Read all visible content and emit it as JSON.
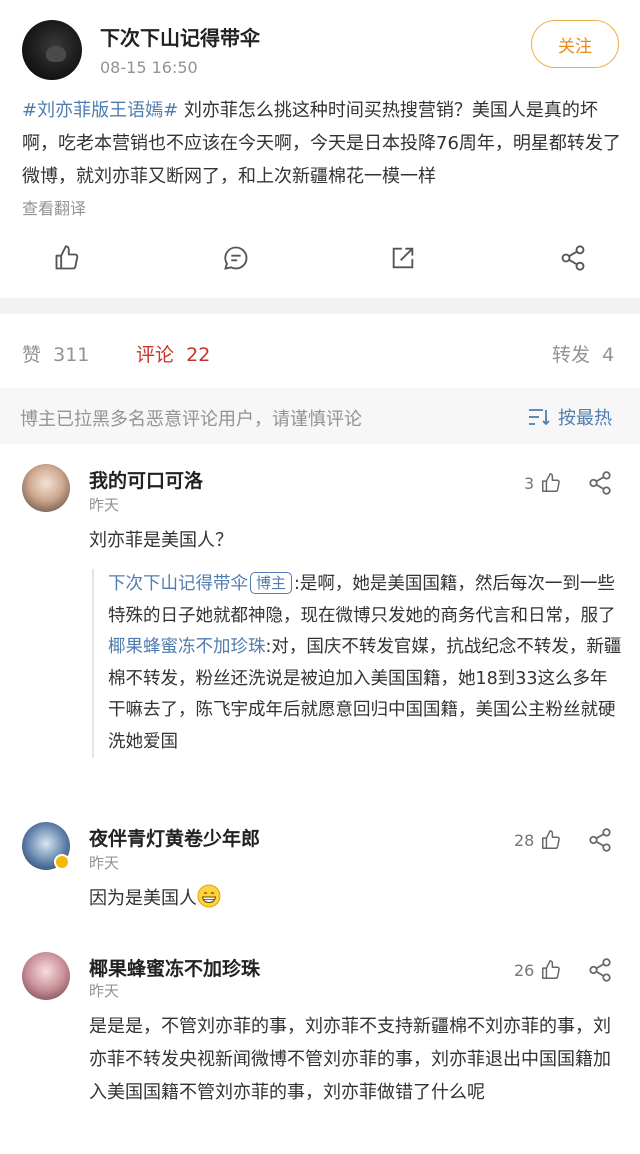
{
  "post": {
    "author": "下次下山记得带伞",
    "time": "08-15 16:50",
    "follow_label": "关注",
    "hashtag": "#刘亦菲版王语嫣#",
    "text": " 刘亦菲怎么挑这种时间买热搜营销？美国人是真的坏啊，吃老本营销也不应该在今天啊，今天是日本投降76周年，明星都转发了微博，就刘亦菲又断网了，和上次新疆棉花一模一样",
    "translate_label": "查看翻译"
  },
  "actions": {
    "like_icon": "thumb-up-icon",
    "comment_icon": "comment-icon",
    "repost_icon": "repost-icon",
    "share_icon": "share-icon"
  },
  "stats": {
    "likes_label": "赞",
    "likes_count": "311",
    "comments_label": "评论",
    "comments_count": "22",
    "reposts_label": "转发",
    "reposts_count": "4"
  },
  "notice": {
    "text": "博主已拉黑多名恶意评论用户，请谨慎评论",
    "sort_label": "按最热"
  },
  "comments": [
    {
      "name": "我的可口可洛",
      "time": "昨天",
      "likes": "3",
      "text": "刘亦菲是美国人？",
      "replies": [
        {
          "name": "下次下山记得带伞",
          "badge": "博主",
          "text": ":是啊，她是美国国籍，然后每次一到一些特殊的日子她就都神隐，现在微博只发她的商务代言和日常，服了"
        },
        {
          "name": "椰果蜂蜜冻不加珍珠",
          "text": ":对，国庆不转发官媒，抗战纪念不转发，新疆棉不转发，粉丝还洗说是被迫加入美国国籍，她18到33这么多年干嘛去了，陈飞宇成年后就愿意回归中国国籍，美国公主粉丝就硬洗她爱国"
        }
      ]
    },
    {
      "name": "夜伴青灯黄卷少年郎",
      "time": "昨天",
      "likes": "28",
      "text": "因为是美国人"
    },
    {
      "name": "椰果蜂蜜冻不加珍珠",
      "time": "昨天",
      "likes": "26",
      "text": "是是是，不管刘亦菲的事，刘亦菲不支持新疆棉不刘亦菲的事，刘亦菲不转发央视新闻微博不管刘亦菲的事，刘亦菲退出中国国籍加入美国国籍不管刘亦菲的事，刘亦菲做错了什么呢"
    }
  ],
  "colors": {
    "link": "#507daf",
    "active_tab": "#c7332a",
    "follow": "#e88a1a",
    "muted": "#939393"
  }
}
